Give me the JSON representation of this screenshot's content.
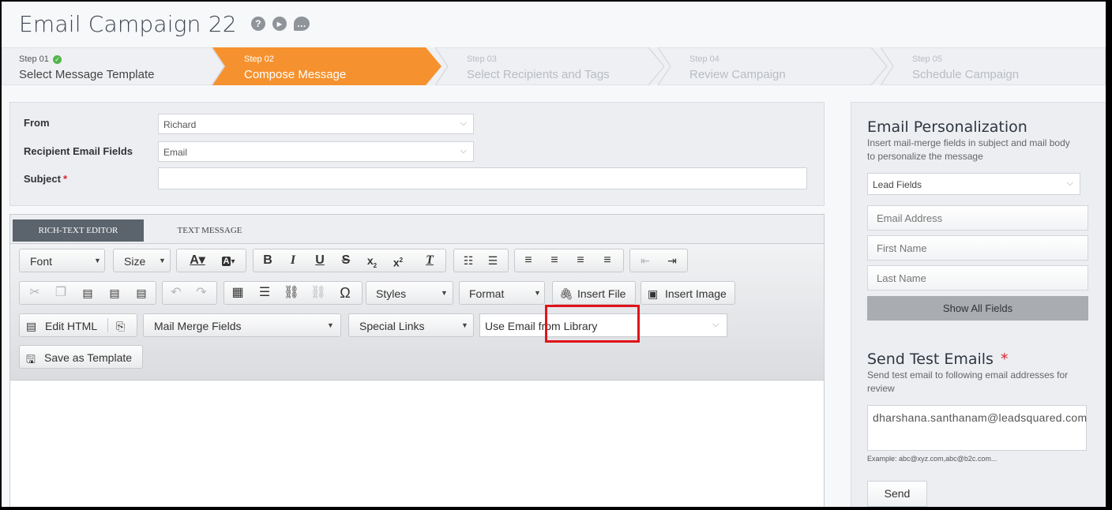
{
  "header": {
    "title": "Email Campaign 22",
    "help_icon": "?",
    "play_icon": "▶",
    "chat_icon": "…"
  },
  "steps": [
    {
      "num": "Step 01",
      "label": "Select Message Template",
      "state": "done"
    },
    {
      "num": "Step 02",
      "label": "Compose Message",
      "state": "active"
    },
    {
      "num": "Step 03",
      "label": "Select Recipients and Tags",
      "state": "future"
    },
    {
      "num": "Step 04",
      "label": "Review Campaign",
      "state": "future"
    },
    {
      "num": "Step 05",
      "label": "Schedule Campaign",
      "state": "future"
    }
  ],
  "colors": {
    "active_step": "#f5922f",
    "highlight": "#e0141a",
    "required": "#d9232d"
  },
  "form": {
    "from_label": "From",
    "from_value": "Richard",
    "recipient_label": "Recipient Email Fields",
    "recipient_value": "Email",
    "subject_label": "Subject",
    "subject_required": "*",
    "subject_value": ""
  },
  "editor": {
    "tabs": [
      "RICH-TEXT EDITOR",
      "TEXT MESSAGE"
    ],
    "font": "Font",
    "size": "Size",
    "styles": "Styles",
    "format": "Format",
    "insert_file": "Insert File",
    "insert_image": "Insert Image",
    "edit_html": "Edit HTML",
    "mail_merge": "Mail Merge Fields",
    "special_links": "Special Links",
    "use_email": "Use Email from Library",
    "save_template": "Save as Template"
  },
  "personalization": {
    "title": "Email Personalization",
    "desc": "Insert mail-merge fields in subject and mail body to personalize the message",
    "select": "Lead Fields",
    "fields": [
      "Email Address",
      "First Name",
      "Last Name"
    ],
    "show_all": "Show All Fields"
  },
  "test": {
    "title": "Send Test Emails",
    "required": "*",
    "desc": "Send test email to following email addresses for review",
    "email_value": "dharshana.santhanam@leadsquared.com",
    "example": "Example: abc@xyz.com,abc@b2c.com...",
    "send": "Send"
  }
}
